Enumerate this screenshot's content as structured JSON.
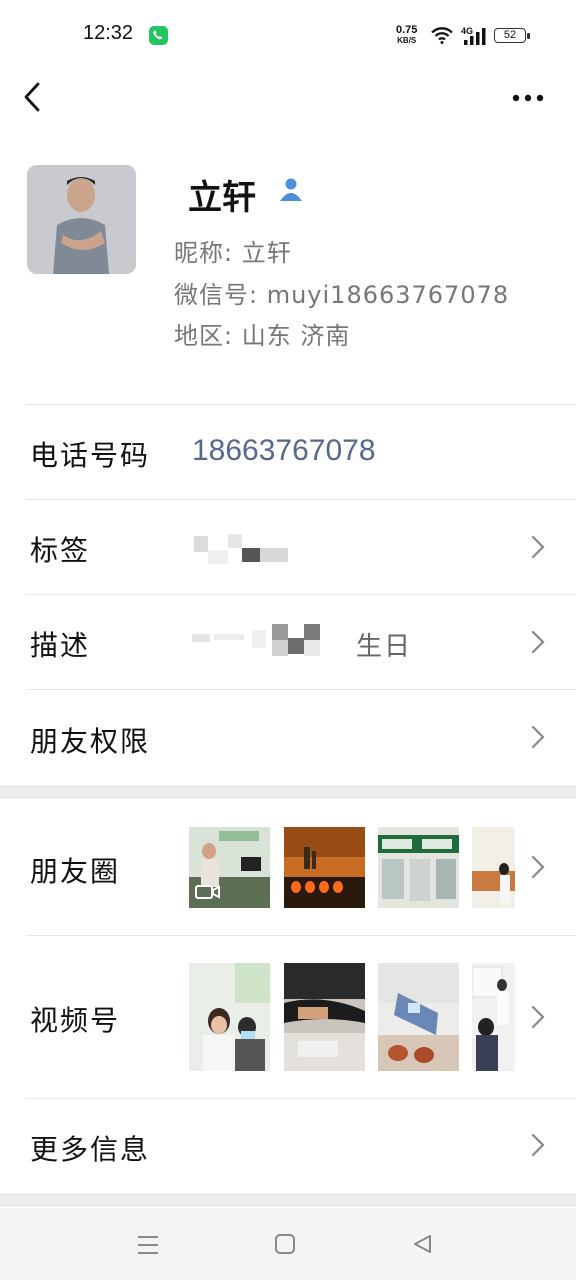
{
  "status_bar": {
    "time": "12:32",
    "speed_value": "0.75",
    "speed_unit": "KB/S",
    "network": "4G",
    "battery": "52"
  },
  "profile": {
    "name": "立轩",
    "nickname_line": "昵称: 立轩",
    "wechat_id_line": "微信号: muyi18663767078",
    "region_line": "地区: 山东 济南"
  },
  "rows": {
    "phone_label": "电话号码",
    "phone_value": "18663767078",
    "tags_label": "标签",
    "desc_label": "描述",
    "desc_value_visible": "生日",
    "permissions_label": "朋友权限",
    "moments_label": "朋友圈",
    "channels_label": "视频号",
    "more_info_label": "更多信息"
  },
  "icons": {
    "back": "chevron-left-icon",
    "more": "more-dots-icon",
    "verified": "person-icon",
    "row_arrow": "chevron-right-icon",
    "video": "video-camera-icon",
    "nav_menu": "menu-icon",
    "nav_home": "home-square-icon",
    "nav_back": "triangle-back-icon"
  },
  "colors": {
    "phone_link": "#56698c",
    "section_gap": "#ededed",
    "verified_icon": "#4a90d9"
  }
}
